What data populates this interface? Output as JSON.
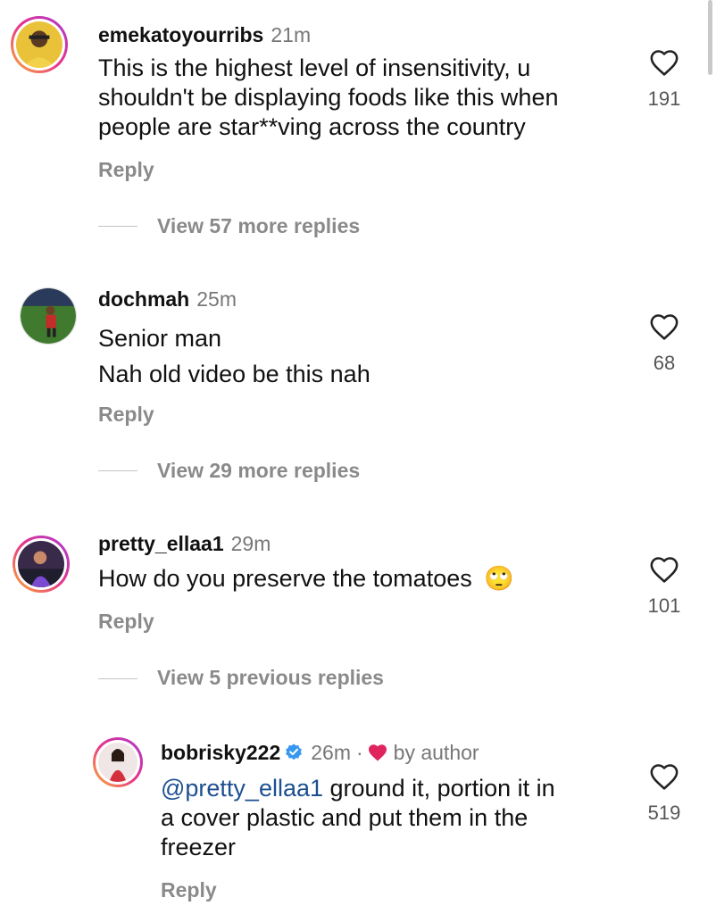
{
  "comments": [
    {
      "username": "emekatoyourribs",
      "time": "21m",
      "lines": [
        "This is the highest level of insensitivity, u",
        "shouldn't be displaying foods like this when",
        "people are star**ving across the country"
      ],
      "reply_label": "Reply",
      "likes": "191",
      "view_replies": "View 57 more replies"
    },
    {
      "username": "dochmah",
      "time": "25m",
      "lines": [
        "Senior man",
        "Nah old video be this nah"
      ],
      "reply_label": "Reply",
      "likes": "68",
      "view_replies": "View 29 more replies"
    },
    {
      "username": "pretty_ellaa1",
      "time": "29m",
      "text": "How do you preserve the tomatoes",
      "emoji": "🙄",
      "reply_label": "Reply",
      "likes": "101",
      "view_replies": "View 5 previous replies"
    }
  ],
  "reply": {
    "username": "bobrisky222",
    "time": "26m",
    "separator": "·",
    "liked_by": "by author",
    "mention": "@pretty_ellaa1",
    "line1_rest": " ground it, portion it in",
    "line2": "a cover plastic and put them in the",
    "line3": "freezer",
    "reply_label": "Reply",
    "likes": "519"
  },
  "colors": {
    "mention": "#1d4f91",
    "heart": "#e0245e",
    "verified": "#3897f0",
    "muted": "#8a8a8a"
  }
}
